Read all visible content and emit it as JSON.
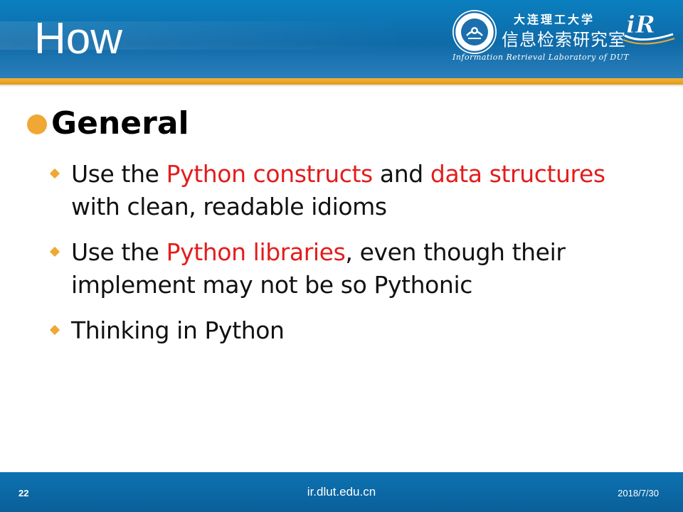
{
  "header": {
    "title": "How",
    "university_name": "大连理工大学",
    "lab_name": "信息检索研究室",
    "lab_name_en": "Information Retrieval Laboratory of DUT",
    "logo_text": "iR"
  },
  "content": {
    "heading": "General",
    "bullets": [
      {
        "lines": [
          [
            {
              "text": "Use the ",
              "highlight": false
            },
            {
              "text": "Python constructs",
              "highlight": true
            },
            {
              "text": " and ",
              "highlight": false
            },
            {
              "text": "data structures",
              "highlight": true
            }
          ],
          [
            {
              "text": "with clean, readable idioms",
              "highlight": false
            }
          ]
        ]
      },
      {
        "lines": [
          [
            {
              "text": "Use the ",
              "highlight": false
            },
            {
              "text": "Python libraries",
              "highlight": true
            },
            {
              "text": ", even though their",
              "highlight": false
            }
          ],
          [
            {
              "text": "implement may not be so Pythonic",
              "highlight": false
            }
          ]
        ]
      },
      {
        "lines": [
          [
            {
              "text": "Thinking in Python",
              "highlight": false
            }
          ]
        ]
      }
    ]
  },
  "footer": {
    "page_number": "22",
    "website": "ir.dlut.edu.cn",
    "date": "2018/7/30"
  },
  "colors": {
    "header_blue": "#0f6aa8",
    "accent_orange": "#f0a733",
    "highlight_red": "#e41c1c"
  }
}
